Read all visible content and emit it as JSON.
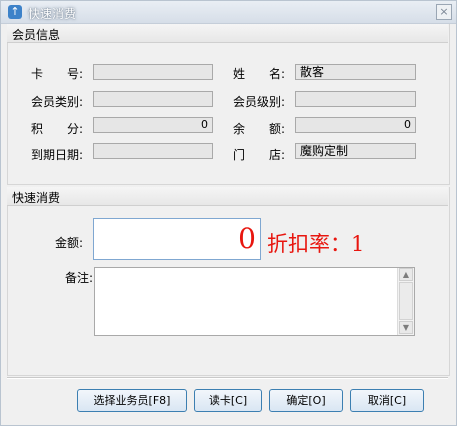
{
  "window": {
    "title": "快速消费",
    "icon": "app-up-arrow-icon",
    "close_glyph": "×"
  },
  "member": {
    "header": "会员信息",
    "card_no": {
      "label": "卡　　号:",
      "value": ""
    },
    "name": {
      "label": "姓　　名:",
      "value": "散客"
    },
    "category": {
      "label": "会员类别:",
      "value": ""
    },
    "level": {
      "label": "会员级别:",
      "value": ""
    },
    "points": {
      "label": "积　　分:",
      "value": "0"
    },
    "balance": {
      "label": "余　　额:",
      "value": "0"
    },
    "expiry": {
      "label": "到期日期:",
      "value": ""
    },
    "store": {
      "label": "门　　店:",
      "value": "魔购定制"
    }
  },
  "consume": {
    "header": "快速消费",
    "amount_label": "金额:",
    "amount_value": "0",
    "discount_text": "折扣率：1",
    "remark_label": "备注:",
    "remark_value": ""
  },
  "buttons": {
    "select_staff": "选择业务员[F8]",
    "read_card": "读卡[C]",
    "confirm": "确定[O]",
    "cancel": "取消[C]"
  },
  "colors": {
    "accent_red": "#e8160f",
    "button_border": "#3c7fb1"
  }
}
